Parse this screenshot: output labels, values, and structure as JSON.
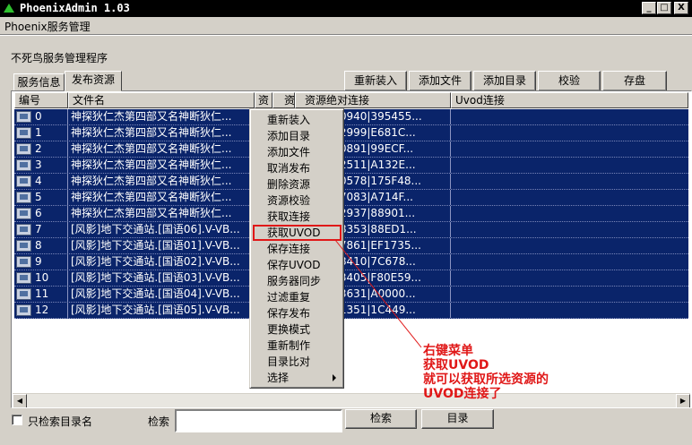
{
  "window": {
    "title": "PhoenixAdmin 1.03",
    "minimize": "_",
    "maximize": "□",
    "close": "X"
  },
  "menubar": {
    "label": "Phoenix服务管理"
  },
  "app": {
    "subtitle": "不死鸟服务管理程序"
  },
  "tabs": [
    {
      "label": "服务信息",
      "active": false
    },
    {
      "label": "发布资源",
      "active": true
    }
  ],
  "toolbar": {
    "reload": "重新装入",
    "add_file": "添加文件",
    "add_dir": "添加目录",
    "verify": "校验",
    "save": "存盘"
  },
  "table": {
    "columns": [
      "编号",
      "文件名",
      "资",
      "资",
      "资源绝对连接",
      "Uvod连接"
    ],
    "rows": [
      {
        "id": "0",
        "name": "神探狄仁杰第四部又名神断狄仁...",
        "link": "0|149040940|395455..."
      },
      {
        "id": "1",
        "name": "神探狄仁杰第四部又名神断狄仁...",
        "link": "0|149082999|E681C..."
      },
      {
        "id": "2",
        "name": "神探狄仁杰第四部又名神断狄仁...",
        "link": "0|149350891|99ECF..."
      },
      {
        "id": "3",
        "name": "神探狄仁杰第四部又名神断狄仁...",
        "link": "0|149222511|A132E..."
      },
      {
        "id": "4",
        "name": "神探狄仁杰第四部又名神断狄仁...",
        "link": "0|149200578|175F48..."
      },
      {
        "id": "5",
        "name": "神探狄仁杰第四部又名神断狄仁...",
        "link": "0|148817083|A714F..."
      },
      {
        "id": "6",
        "name": "神探狄仁杰第四部又名神断狄仁...",
        "link": "0|149072937|88901..."
      },
      {
        "id": "7",
        "name": "[风影]地下交通站.[国语06].V-VB...",
        "link": "0|216488353|88ED1..."
      },
      {
        "id": "8",
        "name": "[风影]地下交通站.[国语01].V-VB...",
        "link": "0|194887861|EF1735..."
      },
      {
        "id": "9",
        "name": "[风影]地下交通站.[国语02].V-VB...",
        "link": "0|194118410|7C678..."
      },
      {
        "id": "10",
        "name": "[风影]地下交通站.[国语03].V-VB...",
        "link": "0|189693405|F80E59..."
      },
      {
        "id": "11",
        "name": "[风影]地下交通站.[国语04].V-VB...",
        "link": "0|185173631|A0000..."
      },
      {
        "id": "12",
        "name": "[风影]地下交通站.[国语05].V-VB...",
        "link": "0|203321351|1C449..."
      }
    ]
  },
  "context_menu": {
    "items": [
      {
        "label": "重新装入"
      },
      {
        "label": "添加目录"
      },
      {
        "label": "添加文件"
      },
      {
        "label": "取消发布"
      },
      {
        "label": "删除资源"
      },
      {
        "label": "资源校验"
      },
      {
        "label": "获取连接"
      },
      {
        "label": "获取UVOD",
        "highlighted": true
      },
      {
        "label": "保存连接"
      },
      {
        "label": "保存UVOD"
      },
      {
        "label": "服务器同步"
      },
      {
        "label": "过滤重复"
      },
      {
        "label": "保存发布"
      },
      {
        "label": "更换模式"
      },
      {
        "label": "重新制作"
      },
      {
        "label": "目录比对"
      },
      {
        "label": "选择",
        "submenu": true
      }
    ]
  },
  "annotation": {
    "lines": [
      "右键菜单",
      "获取UVOD",
      "就可以获取所选资源的",
      "UVOD连接了"
    ],
    "color": "#e01818"
  },
  "footer": {
    "checkbox_label": "只检索目录名",
    "search_label": "检索",
    "search_value": "",
    "search_button": "检索",
    "dir_button": "目录"
  },
  "colors": {
    "selection": "#0a246a",
    "face": "#d4d0c8"
  }
}
